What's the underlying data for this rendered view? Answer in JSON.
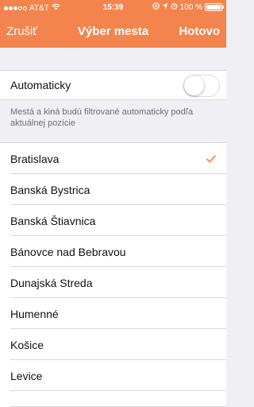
{
  "status_bar": {
    "carrier": "AT&T",
    "time": "15:39",
    "battery_text": "100 %",
    "battery_level": 1.0
  },
  "nav": {
    "left_label": "Zrušiť",
    "title": "Výber mesta",
    "right_label": "Hotovo"
  },
  "auto": {
    "label": "Automaticky",
    "enabled": false,
    "note": "Mestá a kiná budú filtrované automaticky podľa aktuálnej pozície"
  },
  "cities": [
    {
      "name": "Bratislava",
      "selected": true
    },
    {
      "name": "Banská Bystrica",
      "selected": false
    },
    {
      "name": "Banská Štiavnica",
      "selected": false
    },
    {
      "name": "Bánovce nad Bebravou",
      "selected": false
    },
    {
      "name": "Dunajská Streda",
      "selected": false
    },
    {
      "name": "Humenné",
      "selected": false
    },
    {
      "name": "Košice",
      "selected": false
    },
    {
      "name": "Levice",
      "selected": false
    }
  ],
  "colors": {
    "accent": "#f4844d",
    "checkmark": "#f4844d"
  }
}
